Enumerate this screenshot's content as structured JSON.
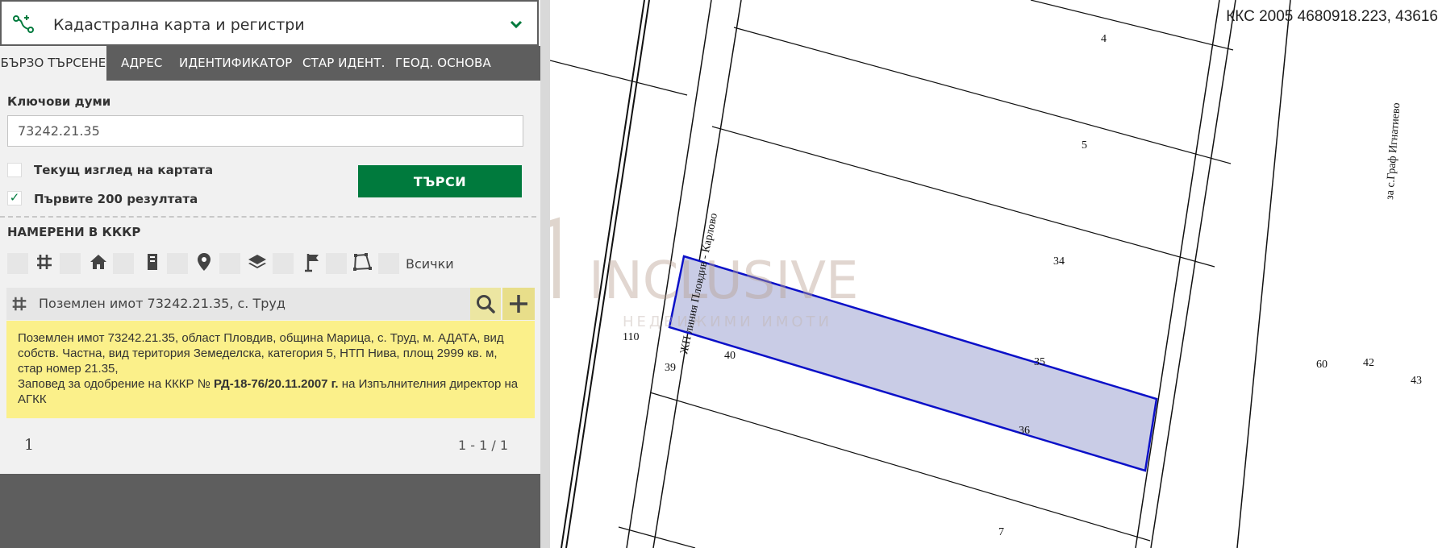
{
  "header": {
    "title": "Кадастрална карта и регистри",
    "logo_icon": "route-icon",
    "toggle_icon": "chevron-down-icon"
  },
  "tabs": [
    {
      "label": "БЪРЗО ТЪРСЕНЕ",
      "active": true
    },
    {
      "label": "АДРЕС",
      "active": false
    },
    {
      "label": "ИДЕНТИФИКАТОР",
      "active": false
    },
    {
      "label": "СТАР ИДЕНТ.",
      "active": false
    },
    {
      "label": "ГЕОД. ОСНОВА",
      "active": false
    }
  ],
  "search": {
    "keywords_label": "Ключови думи",
    "keywords_value": "73242.21.35",
    "current_view_label": "Текущ изглед на картата",
    "current_view_checked": false,
    "first200_label": "Първите 200 резултата",
    "first200_checked": true,
    "first200_mark": "✓",
    "button_label": "ТЪРСИ",
    "button_color": "#007a3d"
  },
  "found": {
    "title": "НАМЕРЕНИ В КККР",
    "filter_icons": [
      "parcel-grid-icon",
      "home-icon",
      "building-icon",
      "map-pin-icon",
      "layers-icon",
      "flag-icon",
      "polygon-icon"
    ],
    "all_label": "Всички"
  },
  "result": {
    "title": "Поземлен имот 73242.21.35, с. Труд",
    "info_line1": "Поземлен имот 73242.21.35, област Пловдив, община Марица, с. Труд, м. АДАТА, вид собств. Частна, вид територия Земеделска, категория 5, НТП Нива, площ 2999 кв. м, стар номер 21.35,",
    "info_order_prefix": "Заповед за одобрение на КККР №",
    "info_order_number": "РД-18-76/20.11.2007 г.",
    "info_order_suffix": "на Изпълнителния директор на АГКК",
    "highlight_color": "#fbf08a"
  },
  "pager": {
    "page": "1",
    "range": "1 - 1 / 1"
  },
  "map": {
    "coords": "ККС 2005 4680918.223, 43616",
    "parcels": [
      "4",
      "5",
      "34",
      "35",
      "36",
      "7",
      "60",
      "42",
      "43",
      "40",
      "39",
      "110"
    ],
    "rail_label": "ЖП линия Пловдив - Карлово",
    "road_label": "за с.Граф Игнатиево",
    "selected_fill": "#c9cce6",
    "selected_stroke": "#0b10c8",
    "watermark": {
      "main": "INCLUSIVE",
      "sub": "НЕДВИЖИМИ ИМОТИ"
    }
  }
}
